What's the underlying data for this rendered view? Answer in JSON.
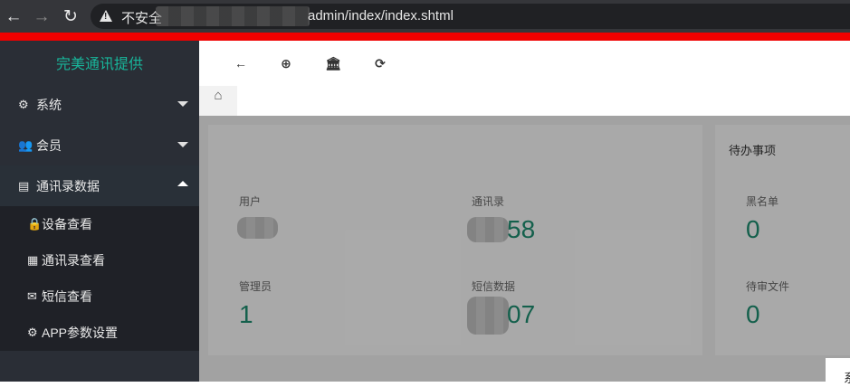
{
  "browser": {
    "back_icon": "arrow-left",
    "forward_icon": "arrow-right",
    "reload_icon": "reload",
    "insecure_label": "不安全",
    "url_visible_tail": "admin/index/index.shtml"
  },
  "sidebar": {
    "brand": "完美通讯提供",
    "items": [
      {
        "label": "系统",
        "icon": "gear-icon",
        "expanded": false
      },
      {
        "label": "会员",
        "icon": "users-icon",
        "expanded": false
      },
      {
        "label": "通讯录数据",
        "icon": "id-card-icon",
        "expanded": true
      }
    ],
    "subitems": [
      {
        "label": "设备查看",
        "icon": "lock-icon"
      },
      {
        "label": "通讯录查看",
        "icon": "building-icon"
      },
      {
        "label": "短信查看",
        "icon": "envelope-icon"
      },
      {
        "label": "APP参数设置",
        "icon": "gear-icon"
      }
    ]
  },
  "toolbar": {
    "buttons": [
      "back-arrow-icon",
      "lifebuoy-icon",
      "bank-icon",
      "refresh-icon"
    ]
  },
  "tabs": {
    "home_icon": "home-icon"
  },
  "dashboard": {
    "todo_title": "待办事项",
    "cards": [
      {
        "label": "用户",
        "value": ""
      },
      {
        "label": "通讯录",
        "value": "58"
      },
      {
        "label": "黑名单",
        "value": "0"
      },
      {
        "label": "管理员",
        "value": "1"
      },
      {
        "label": "短信数据",
        "value": "07"
      },
      {
        "label": "待审文件",
        "value": "0"
      }
    ],
    "popup_char": "系"
  },
  "colors": {
    "accent": "#18b69b",
    "sidebar_bg": "#2a2e36",
    "alert_bar": "#f00000",
    "value_color": "#1e8a6e"
  }
}
